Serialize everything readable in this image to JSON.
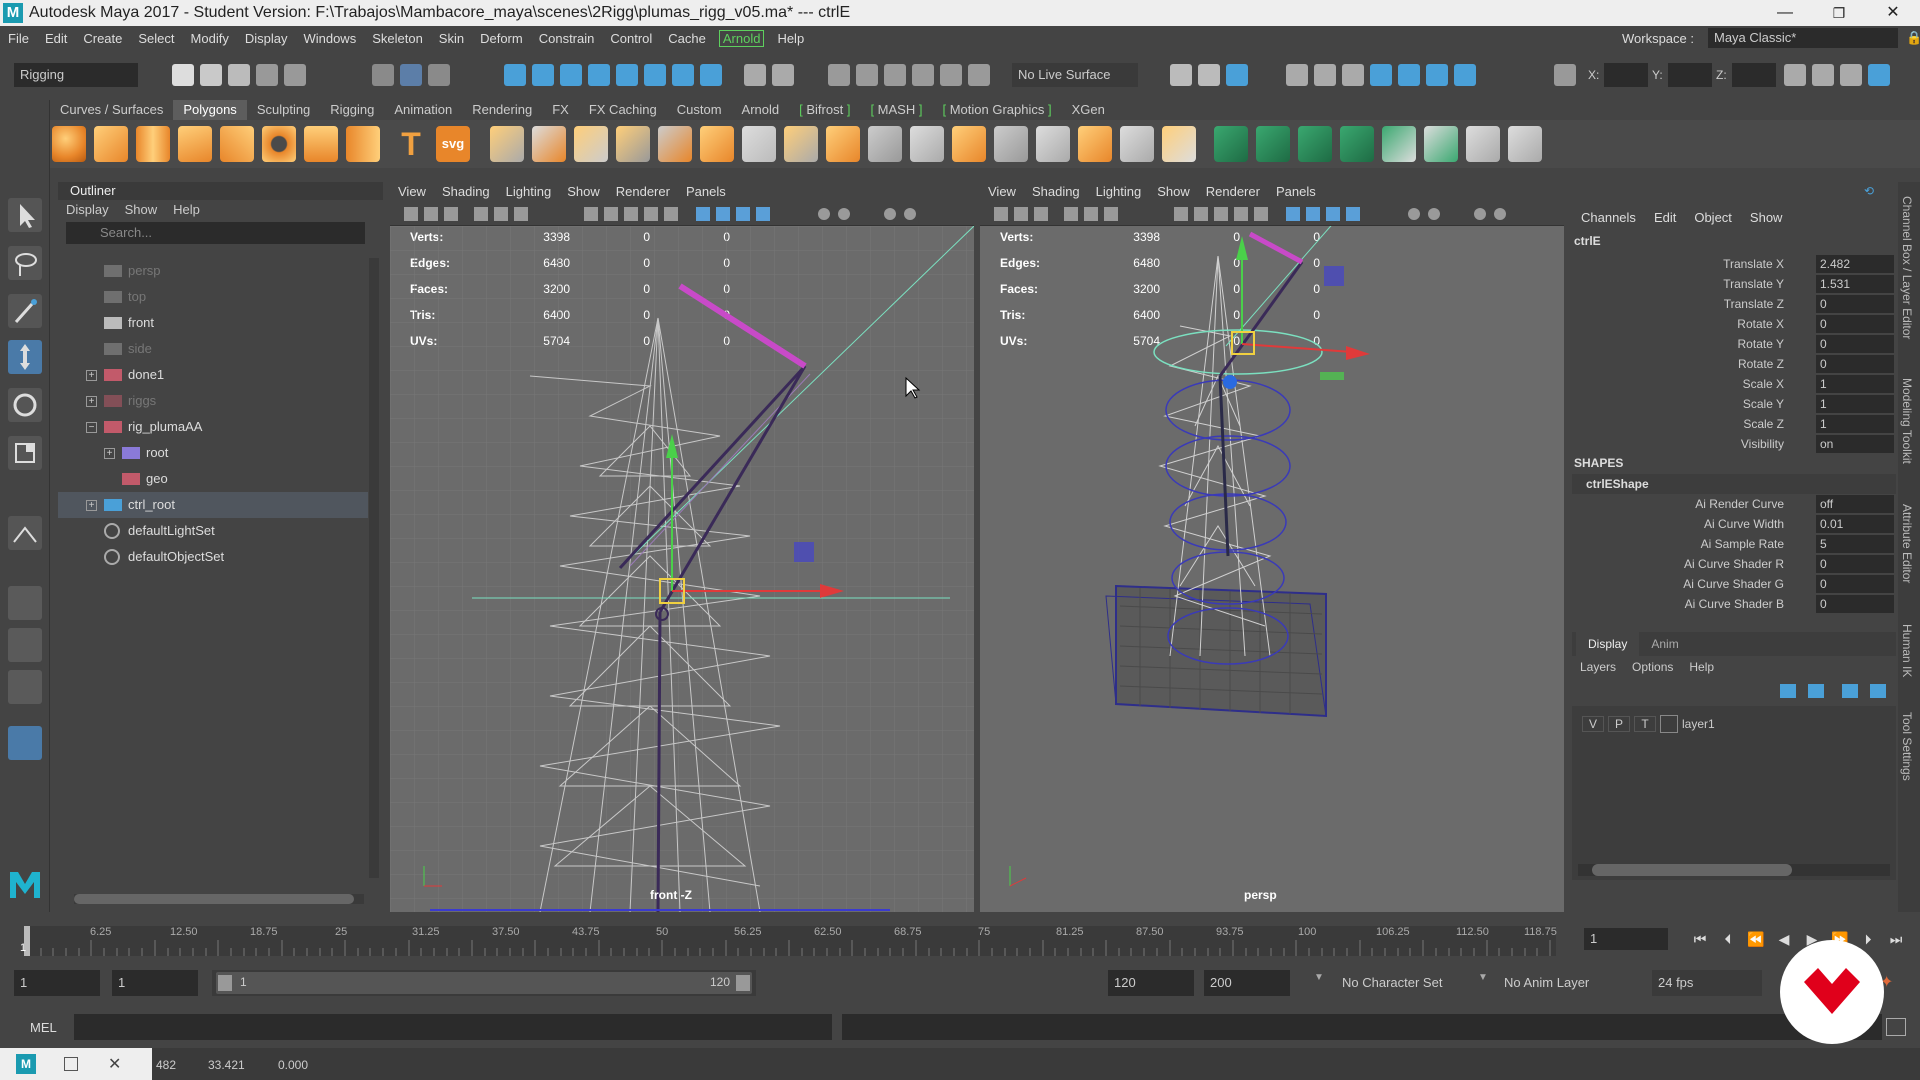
{
  "window": {
    "title": "Autodesk Maya 2017 - Student Version: F:\\Trabajos\\Mambacore_maya\\scenes\\2Rigg\\plumas_rigg_v05.ma*   ---   ctrlE",
    "minimize": "—",
    "maximize": "❐",
    "close": "✕"
  },
  "menubar": {
    "items": [
      "File",
      "Edit",
      "Create",
      "Select",
      "Modify",
      "Display",
      "Windows",
      "Skeleton",
      "Skin",
      "Deform",
      "Constrain",
      "Control",
      "Cache"
    ],
    "highlight": "Arnold",
    "help": "Help",
    "workspace_label": "Workspace :",
    "workspace_value": "Maya Classic*"
  },
  "statusline": {
    "mode": "Rigging",
    "live_surface": "No Live Surface",
    "x_label": "X:",
    "y_label": "Y:",
    "z_label": "Z:"
  },
  "shelf": {
    "tabs": [
      "Curves / Surfaces",
      "Polygons",
      "Sculpting",
      "Rigging",
      "Animation",
      "Rendering",
      "FX",
      "FX Caching",
      "Custom",
      "Arnold",
      "Bifrost",
      "MASH",
      "Motion Graphics",
      "XGen"
    ],
    "active": "Polygons",
    "text_icon": "T",
    "svg_icon": "svg"
  },
  "outliner": {
    "title": "Outliner",
    "menu": [
      "Display",
      "Show",
      "Help"
    ],
    "search_placeholder": "Search...",
    "items": [
      {
        "label": "persp",
        "dim": true
      },
      {
        "label": "top",
        "dim": true
      },
      {
        "label": "front",
        "dim": false
      },
      {
        "label": "side",
        "dim": true
      },
      {
        "label": "done1",
        "dim": false
      },
      {
        "label": "riggs",
        "dim": true
      },
      {
        "label": "rig_plumaAA",
        "dim": false
      },
      {
        "label": "root",
        "dim": false
      },
      {
        "label": "geo",
        "dim": false
      },
      {
        "label": "ctrl_root",
        "dim": false
      },
      {
        "label": "defaultLightSet",
        "dim": false
      },
      {
        "label": "defaultObjectSet",
        "dim": false
      }
    ]
  },
  "viewport_menu": [
    "View",
    "Shading",
    "Lighting",
    "Show",
    "Renderer",
    "Panels"
  ],
  "hud": {
    "rows": [
      {
        "label": "Verts:",
        "a": "3398",
        "b": "0",
        "c": "0"
      },
      {
        "label": "Edges:",
        "a": "6480",
        "b": "0",
        "c": "0"
      },
      {
        "label": "Faces:",
        "a": "3200",
        "b": "0",
        "c": "0"
      },
      {
        "label": "Tris:",
        "a": "6400",
        "b": "0",
        "c": "0"
      },
      {
        "label": "UVs:",
        "a": "5704",
        "b": "0",
        "c": "0"
      }
    ]
  },
  "viewports": {
    "left_label": "front -Z",
    "right_label": "persp"
  },
  "channelbox": {
    "menu": [
      "Channels",
      "Edit",
      "Object",
      "Show"
    ],
    "object": "ctrlE",
    "channels": [
      {
        "name": "Translate X",
        "value": "2.482"
      },
      {
        "name": "Translate Y",
        "value": "1.531"
      },
      {
        "name": "Translate Z",
        "value": "0"
      },
      {
        "name": "Rotate X",
        "value": "0"
      },
      {
        "name": "Rotate Y",
        "value": "0"
      },
      {
        "name": "Rotate Z",
        "value": "0"
      },
      {
        "name": "Scale X",
        "value": "1"
      },
      {
        "name": "Scale Y",
        "value": "1"
      },
      {
        "name": "Scale Z",
        "value": "1"
      },
      {
        "name": "Visibility",
        "value": "on"
      }
    ],
    "shapes_header": "SHAPES",
    "shape_name": "ctrlEShape",
    "shape_attrs": [
      {
        "name": "Ai Render Curve",
        "value": "off"
      },
      {
        "name": "Ai Curve Width",
        "value": "0.01"
      },
      {
        "name": "Ai Sample Rate",
        "value": "5"
      },
      {
        "name": "Ai Curve Shader R",
        "value": "0"
      },
      {
        "name": "Ai Curve Shader G",
        "value": "0"
      },
      {
        "name": "Ai Curve Shader B",
        "value": "0"
      }
    ]
  },
  "layers": {
    "tabs": [
      "Display",
      "Anim"
    ],
    "menu": [
      "Layers",
      "Options",
      "Help"
    ],
    "v": "V",
    "p": "P",
    "t": "T",
    "layer_name": "layer1"
  },
  "side_tabs": [
    "Channel Box / Layer Editor",
    "Modeling Toolkit",
    "Attribute Editor",
    "Human IK",
    "Tool Settings"
  ],
  "timeslider": {
    "ticks": [
      "6.25",
      "12.50",
      "18.75",
      "25",
      "31.25",
      "37.50",
      "43.75",
      "50",
      "56.25",
      "62.50",
      "68.75",
      "75",
      "81.25",
      "87.50",
      "93.75",
      "100",
      "106.25",
      "112.50",
      "118.75"
    ],
    "current_frame_marker": "1",
    "current_frame_field": "1"
  },
  "range": {
    "start": "1",
    "playback_start": "1",
    "slider_start": "1",
    "slider_end": "120",
    "playback_end": "120",
    "end": "200",
    "character_set": "No Character Set",
    "anim_layer": "No Anim Layer",
    "fps": "24 fps"
  },
  "cmdline": {
    "label": "MEL"
  },
  "helpline": {
    "coords": [
      "482",
      "33.421",
      "0.000"
    ]
  },
  "colors": {
    "accent_green": "#5ed05e",
    "selection": "#50565e",
    "viewport_bg": "#6b6b6b",
    "watermark_red": "#e0001b"
  }
}
